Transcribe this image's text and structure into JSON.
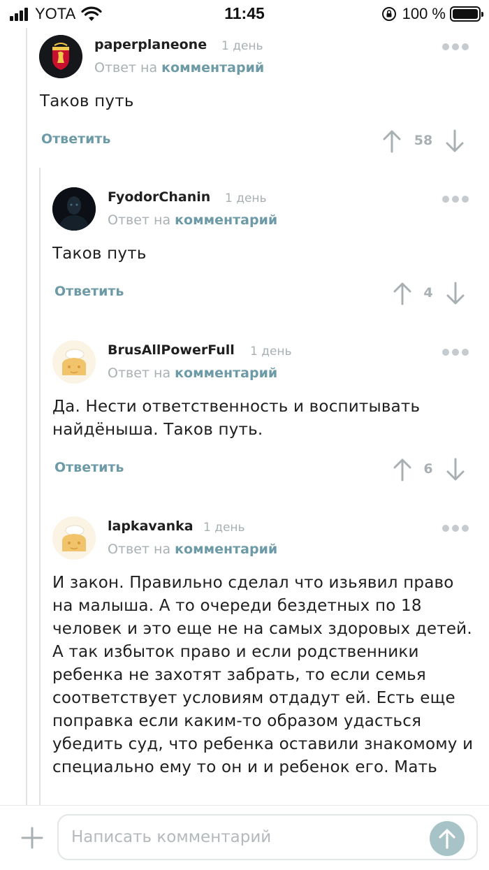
{
  "status_bar": {
    "carrier": "YOTA",
    "time": "11:45",
    "battery": "100 %"
  },
  "thread": {
    "comments": [
      {
        "author": "paperplaneone",
        "date": "1 день",
        "reply_prefix": "Ответ на",
        "reply_link": "комментарий",
        "text": "Таков путь",
        "reply_label": "Ответить",
        "rating": "58"
      },
      {
        "author": "FyodorChanin",
        "date": "1 день",
        "reply_prefix": "Ответ на",
        "reply_link": "комментарий",
        "text": "Таков путь",
        "reply_label": "Ответить",
        "rating": "4"
      },
      {
        "author": "BrusAllPowerFull",
        "date": "1 день",
        "reply_prefix": "Ответ на",
        "reply_link": "комментарий",
        "text": "Да. Нести ответственность и воспитывать найдёныша. Таков путь.",
        "reply_label": "Ответить",
        "rating": "6"
      },
      {
        "author": "lapkavanka",
        "date": "1 день",
        "reply_prefix": "Ответ на",
        "reply_link": "комментарий",
        "text": "И закон. Правильно сделал что изьявил право на малыша. А то очереди бездетных по 18 человек и это еще не на самых здоровых детей. А так избыток право и если родственники ребенка не захотят забрать, то если семья соответствует условиям отдадут ей. Есть еще поправка если каким-то образом удасться убедить суд, что ребенка оставили знакомому и специально ему то он и и ребенок его. Мать"
      }
    ]
  },
  "composer": {
    "placeholder": "Написать комментарий"
  },
  "colors": {
    "accent": "#6c9aa6",
    "muted": "#a9b0b3",
    "send_button": "#a8c3c8"
  },
  "icons": {
    "signal": "signal-icon",
    "wifi": "wifi-icon",
    "lock": "orientation-lock-icon",
    "battery": "battery-icon",
    "more": "more-dots-icon",
    "upvote": "arrow-up-icon",
    "downvote": "arrow-down-icon",
    "plus": "plus-icon",
    "send": "send-arrow-icon"
  }
}
